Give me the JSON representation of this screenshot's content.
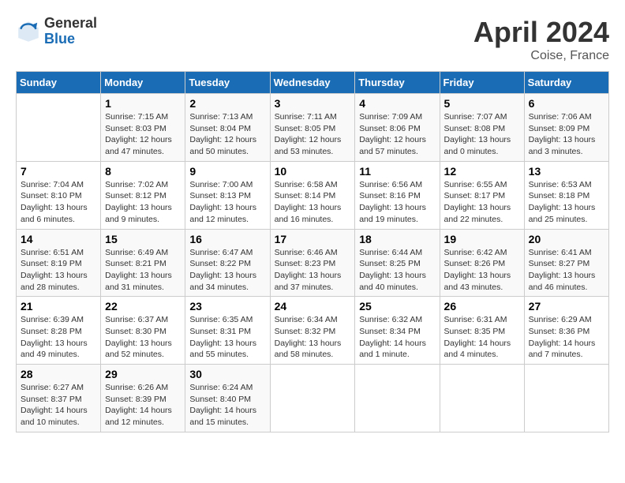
{
  "header": {
    "logo_general": "General",
    "logo_blue": "Blue",
    "month_title": "April 2024",
    "location": "Coise, France"
  },
  "columns": [
    "Sunday",
    "Monday",
    "Tuesday",
    "Wednesday",
    "Thursday",
    "Friday",
    "Saturday"
  ],
  "weeks": [
    [
      {
        "day": "",
        "sunrise": "",
        "sunset": "",
        "daylight": ""
      },
      {
        "day": "1",
        "sunrise": "Sunrise: 7:15 AM",
        "sunset": "Sunset: 8:03 PM",
        "daylight": "Daylight: 12 hours and 47 minutes."
      },
      {
        "day": "2",
        "sunrise": "Sunrise: 7:13 AM",
        "sunset": "Sunset: 8:04 PM",
        "daylight": "Daylight: 12 hours and 50 minutes."
      },
      {
        "day": "3",
        "sunrise": "Sunrise: 7:11 AM",
        "sunset": "Sunset: 8:05 PM",
        "daylight": "Daylight: 12 hours and 53 minutes."
      },
      {
        "day": "4",
        "sunrise": "Sunrise: 7:09 AM",
        "sunset": "Sunset: 8:06 PM",
        "daylight": "Daylight: 12 hours and 57 minutes."
      },
      {
        "day": "5",
        "sunrise": "Sunrise: 7:07 AM",
        "sunset": "Sunset: 8:08 PM",
        "daylight": "Daylight: 13 hours and 0 minutes."
      },
      {
        "day": "6",
        "sunrise": "Sunrise: 7:06 AM",
        "sunset": "Sunset: 8:09 PM",
        "daylight": "Daylight: 13 hours and 3 minutes."
      }
    ],
    [
      {
        "day": "7",
        "sunrise": "Sunrise: 7:04 AM",
        "sunset": "Sunset: 8:10 PM",
        "daylight": "Daylight: 13 hours and 6 minutes."
      },
      {
        "day": "8",
        "sunrise": "Sunrise: 7:02 AM",
        "sunset": "Sunset: 8:12 PM",
        "daylight": "Daylight: 13 hours and 9 minutes."
      },
      {
        "day": "9",
        "sunrise": "Sunrise: 7:00 AM",
        "sunset": "Sunset: 8:13 PM",
        "daylight": "Daylight: 13 hours and 12 minutes."
      },
      {
        "day": "10",
        "sunrise": "Sunrise: 6:58 AM",
        "sunset": "Sunset: 8:14 PM",
        "daylight": "Daylight: 13 hours and 16 minutes."
      },
      {
        "day": "11",
        "sunrise": "Sunrise: 6:56 AM",
        "sunset": "Sunset: 8:16 PM",
        "daylight": "Daylight: 13 hours and 19 minutes."
      },
      {
        "day": "12",
        "sunrise": "Sunrise: 6:55 AM",
        "sunset": "Sunset: 8:17 PM",
        "daylight": "Daylight: 13 hours and 22 minutes."
      },
      {
        "day": "13",
        "sunrise": "Sunrise: 6:53 AM",
        "sunset": "Sunset: 8:18 PM",
        "daylight": "Daylight: 13 hours and 25 minutes."
      }
    ],
    [
      {
        "day": "14",
        "sunrise": "Sunrise: 6:51 AM",
        "sunset": "Sunset: 8:19 PM",
        "daylight": "Daylight: 13 hours and 28 minutes."
      },
      {
        "day": "15",
        "sunrise": "Sunrise: 6:49 AM",
        "sunset": "Sunset: 8:21 PM",
        "daylight": "Daylight: 13 hours and 31 minutes."
      },
      {
        "day": "16",
        "sunrise": "Sunrise: 6:47 AM",
        "sunset": "Sunset: 8:22 PM",
        "daylight": "Daylight: 13 hours and 34 minutes."
      },
      {
        "day": "17",
        "sunrise": "Sunrise: 6:46 AM",
        "sunset": "Sunset: 8:23 PM",
        "daylight": "Daylight: 13 hours and 37 minutes."
      },
      {
        "day": "18",
        "sunrise": "Sunrise: 6:44 AM",
        "sunset": "Sunset: 8:25 PM",
        "daylight": "Daylight: 13 hours and 40 minutes."
      },
      {
        "day": "19",
        "sunrise": "Sunrise: 6:42 AM",
        "sunset": "Sunset: 8:26 PM",
        "daylight": "Daylight: 13 hours and 43 minutes."
      },
      {
        "day": "20",
        "sunrise": "Sunrise: 6:41 AM",
        "sunset": "Sunset: 8:27 PM",
        "daylight": "Daylight: 13 hours and 46 minutes."
      }
    ],
    [
      {
        "day": "21",
        "sunrise": "Sunrise: 6:39 AM",
        "sunset": "Sunset: 8:28 PM",
        "daylight": "Daylight: 13 hours and 49 minutes."
      },
      {
        "day": "22",
        "sunrise": "Sunrise: 6:37 AM",
        "sunset": "Sunset: 8:30 PM",
        "daylight": "Daylight: 13 hours and 52 minutes."
      },
      {
        "day": "23",
        "sunrise": "Sunrise: 6:35 AM",
        "sunset": "Sunset: 8:31 PM",
        "daylight": "Daylight: 13 hours and 55 minutes."
      },
      {
        "day": "24",
        "sunrise": "Sunrise: 6:34 AM",
        "sunset": "Sunset: 8:32 PM",
        "daylight": "Daylight: 13 hours and 58 minutes."
      },
      {
        "day": "25",
        "sunrise": "Sunrise: 6:32 AM",
        "sunset": "Sunset: 8:34 PM",
        "daylight": "Daylight: 14 hours and 1 minute."
      },
      {
        "day": "26",
        "sunrise": "Sunrise: 6:31 AM",
        "sunset": "Sunset: 8:35 PM",
        "daylight": "Daylight: 14 hours and 4 minutes."
      },
      {
        "day": "27",
        "sunrise": "Sunrise: 6:29 AM",
        "sunset": "Sunset: 8:36 PM",
        "daylight": "Daylight: 14 hours and 7 minutes."
      }
    ],
    [
      {
        "day": "28",
        "sunrise": "Sunrise: 6:27 AM",
        "sunset": "Sunset: 8:37 PM",
        "daylight": "Daylight: 14 hours and 10 minutes."
      },
      {
        "day": "29",
        "sunrise": "Sunrise: 6:26 AM",
        "sunset": "Sunset: 8:39 PM",
        "daylight": "Daylight: 14 hours and 12 minutes."
      },
      {
        "day": "30",
        "sunrise": "Sunrise: 6:24 AM",
        "sunset": "Sunset: 8:40 PM",
        "daylight": "Daylight: 14 hours and 15 minutes."
      },
      {
        "day": "",
        "sunrise": "",
        "sunset": "",
        "daylight": ""
      },
      {
        "day": "",
        "sunrise": "",
        "sunset": "",
        "daylight": ""
      },
      {
        "day": "",
        "sunrise": "",
        "sunset": "",
        "daylight": ""
      },
      {
        "day": "",
        "sunrise": "",
        "sunset": "",
        "daylight": ""
      }
    ]
  ]
}
